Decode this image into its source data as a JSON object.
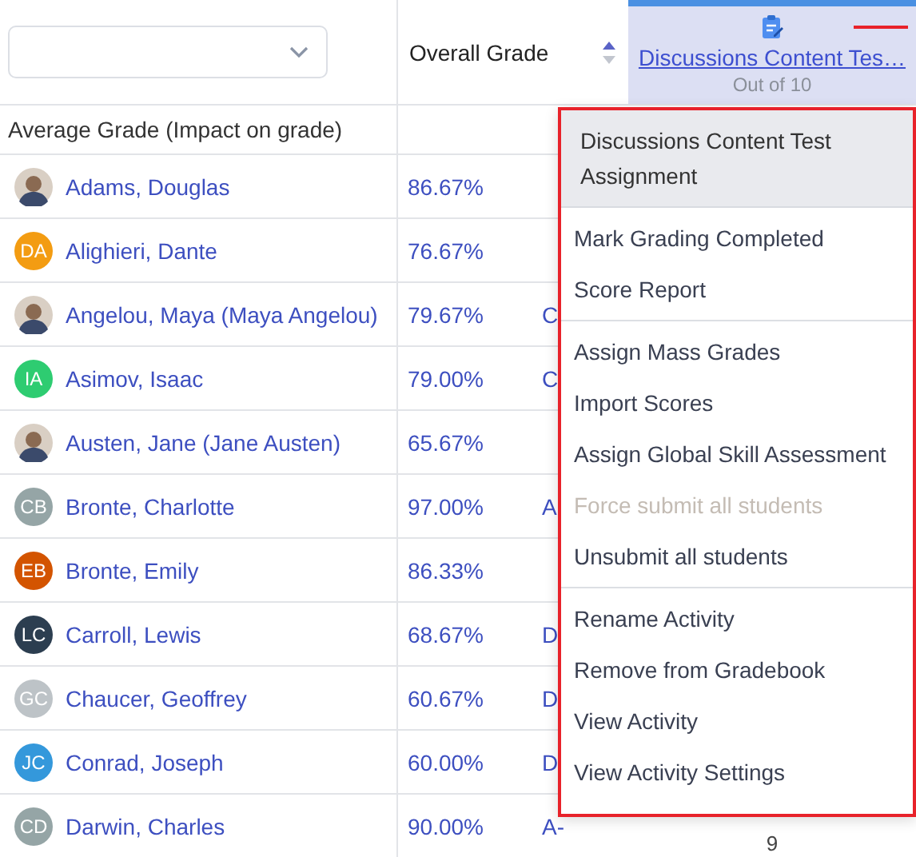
{
  "header": {
    "overall_grade": "Overall Grade",
    "activity": {
      "title": "Discussions Content Tes…",
      "subtitle": "Out of 10",
      "selected": true
    }
  },
  "average_row": {
    "label": "Average Grade (Impact on grade)"
  },
  "students": [
    {
      "name": "Adams, Douglas",
      "avatar": {
        "kind": "photo"
      },
      "percent": "86.67%"
    },
    {
      "name": "Alighieri, Dante",
      "avatar": {
        "kind": "initials",
        "initials": "DA",
        "color": "#f39c12"
      },
      "percent": "76.67%"
    },
    {
      "name": "Angelou, Maya (Maya Angelou)",
      "avatar": {
        "kind": "photo"
      },
      "percent": "79.67%",
      "letter": "C"
    },
    {
      "name": "Asimov, Isaac",
      "avatar": {
        "kind": "initials",
        "initials": "IA",
        "color": "#2ecc71"
      },
      "percent": "79.00%",
      "letter": "C"
    },
    {
      "name": "Austen, Jane (Jane Austen)",
      "avatar": {
        "kind": "photo"
      },
      "percent": "65.67%"
    },
    {
      "name": "Bronte, Charlotte",
      "avatar": {
        "kind": "initials",
        "initials": "CB",
        "color": "#95a5a6"
      },
      "percent": "97.00%",
      "letter": "A"
    },
    {
      "name": "Bronte, Emily",
      "avatar": {
        "kind": "initials",
        "initials": "EB",
        "color": "#d35400"
      },
      "percent": "86.33%"
    },
    {
      "name": "Carroll, Lewis",
      "avatar": {
        "kind": "initials",
        "initials": "LC",
        "color": "#2c3e50"
      },
      "percent": "68.67%",
      "letter": "D"
    },
    {
      "name": "Chaucer, Geoffrey",
      "avatar": {
        "kind": "initials",
        "initials": "GC",
        "color": "#bdc3c7"
      },
      "percent": "60.67%",
      "letter": "D"
    },
    {
      "name": "Conrad, Joseph",
      "avatar": {
        "kind": "initials",
        "initials": "JC",
        "color": "#3498db"
      },
      "percent": "60.00%",
      "letter": "D"
    },
    {
      "name": "Darwin, Charles",
      "avatar": {
        "kind": "initials",
        "initials": "CD",
        "color": "#95a5a6"
      },
      "percent": "90.00%",
      "letter": "A-",
      "score": "9"
    }
  ],
  "menu": {
    "title": "Discussions Content Test Assignment",
    "sections": [
      [
        {
          "label": "Mark Grading Completed",
          "disabled": false
        },
        {
          "label": "Score Report",
          "disabled": false
        }
      ],
      [
        {
          "label": "Assign Mass Grades",
          "disabled": false
        },
        {
          "label": "Import Scores",
          "disabled": false
        },
        {
          "label": "Assign Global Skill Assessment",
          "disabled": false
        },
        {
          "label": "Force submit all students",
          "disabled": true
        },
        {
          "label": "Unsubmit all students",
          "disabled": false
        }
      ],
      [
        {
          "label": "Rename Activity",
          "disabled": false
        },
        {
          "label": "Remove from Gradebook",
          "disabled": false
        },
        {
          "label": "View Activity",
          "disabled": false
        },
        {
          "label": "View Activity Settings",
          "disabled": false
        }
      ]
    ]
  }
}
